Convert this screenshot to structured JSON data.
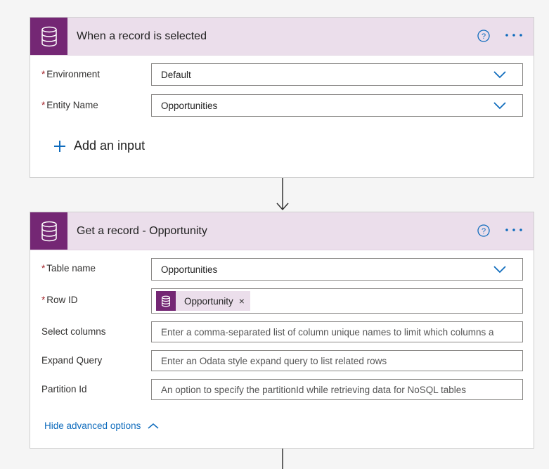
{
  "trigger": {
    "title": "When a record is selected",
    "fields": [
      {
        "label": "Environment",
        "value": "Default",
        "required": "*"
      },
      {
        "label": "Entity Name",
        "value": "Opportunities",
        "required": "*"
      }
    ],
    "add_input_label": "Add an input"
  },
  "action": {
    "title": "Get a record - Opportunity",
    "table_name": {
      "label": "Table name",
      "value": "Opportunities",
      "required": "*"
    },
    "row_id": {
      "label": "Row ID",
      "token_label": "Opportunity",
      "token_close": "×",
      "required": "*"
    },
    "select_columns": {
      "label": "Select columns",
      "placeholder": "Enter a comma-separated list of column unique names to limit which columns a"
    },
    "expand_query": {
      "label": "Expand Query",
      "placeholder": "Enter an Odata style expand query to list related rows"
    },
    "partition_id": {
      "label": "Partition Id",
      "placeholder": "An option to specify the partitionId while retrieving data for NoSQL tables"
    },
    "advanced_toggle_label": "Hide advanced options"
  },
  "icons": {
    "connector": "database-icon",
    "help": "help-icon",
    "more": "more-options-icon",
    "dropdown": "chevron-down-icon",
    "add": "plus-icon",
    "collapse": "chevron-up-icon"
  },
  "colors": {
    "connector_bg": "#742774",
    "header_bg": "#ebdeeb",
    "accent_blue": "#0f6cbd",
    "required_red": "#a4262c"
  }
}
